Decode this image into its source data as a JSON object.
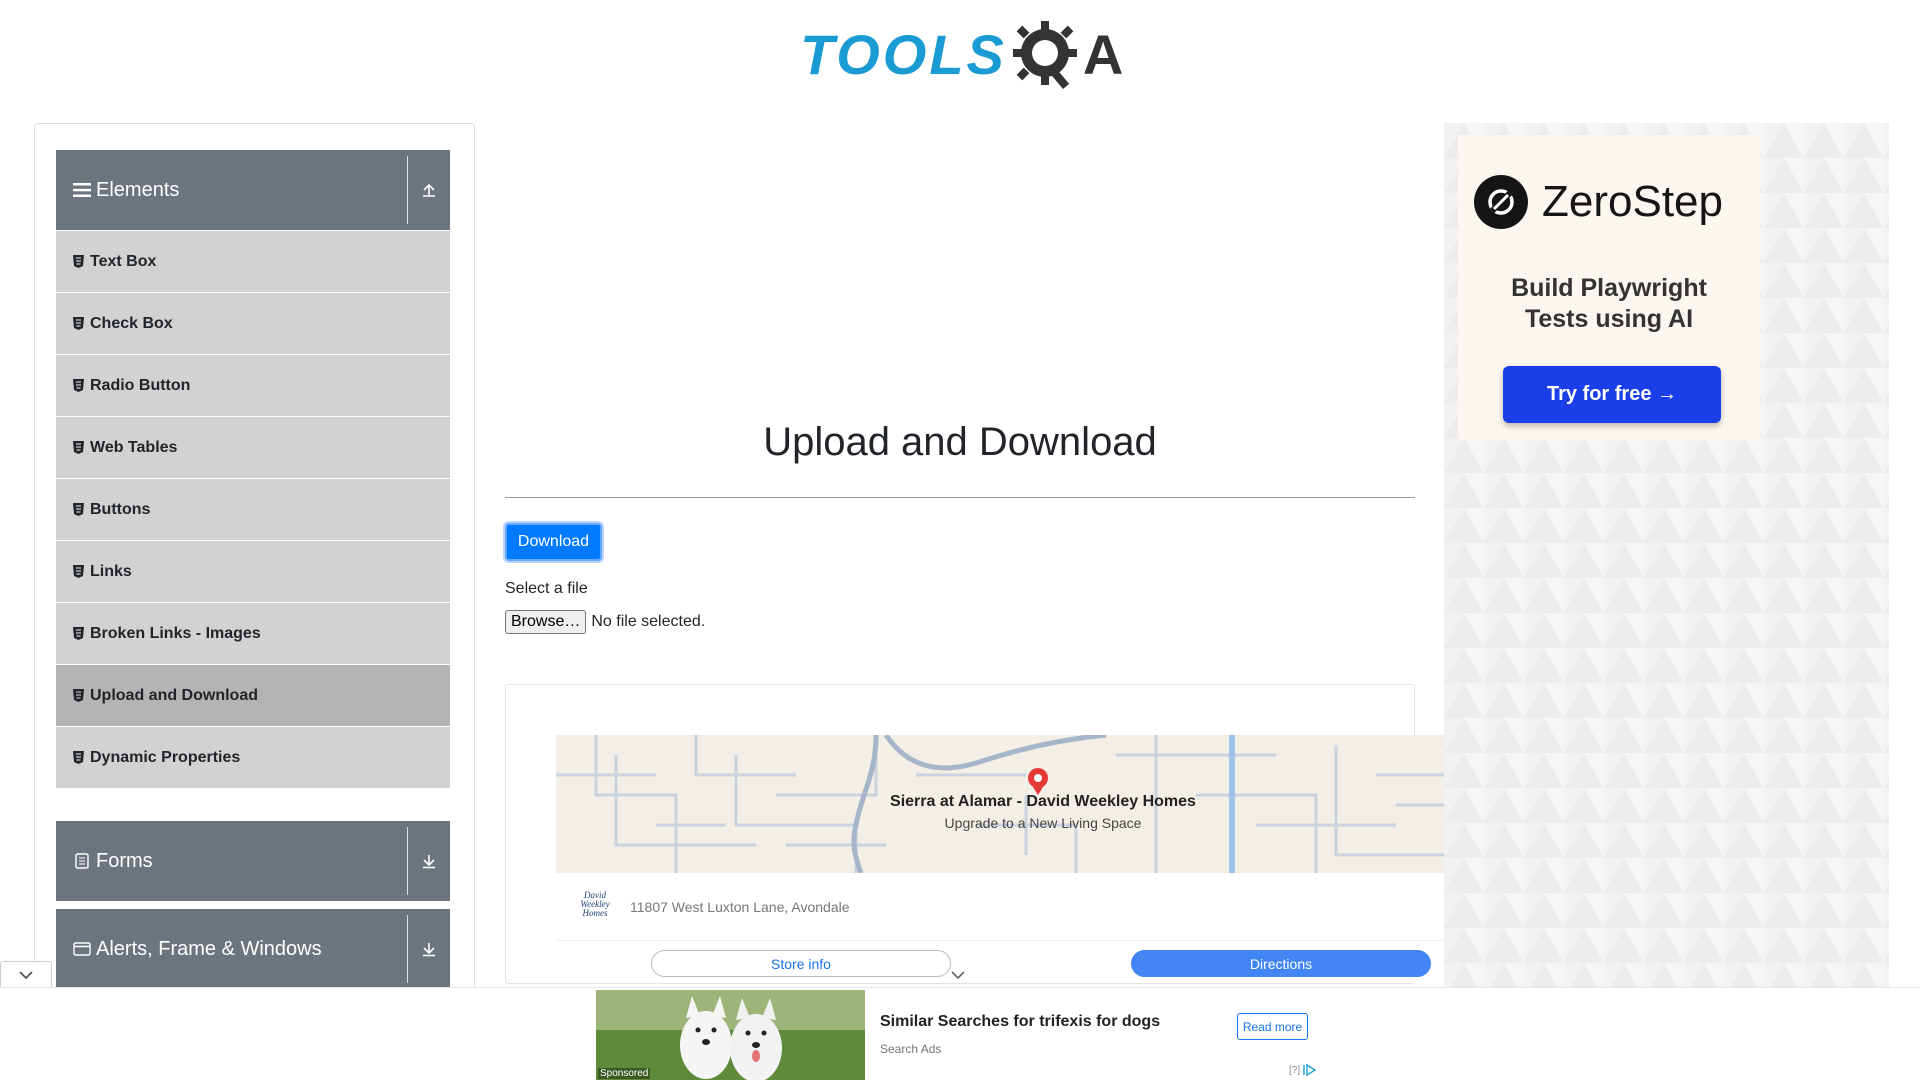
{
  "header": {
    "logo_text_left": "TOOLS",
    "logo_text_right": "A",
    "logo_alt": "TOOLSQA"
  },
  "sidebar": {
    "groups": [
      {
        "title": "Elements",
        "icon": "hamburger-icon",
        "toggle_icon": "collapse-up-icon",
        "expanded": true
      },
      {
        "title": "Forms",
        "icon": "form-icon",
        "toggle_icon": "expand-down-icon",
        "expanded": false
      },
      {
        "title": "Alerts, Frame & Windows",
        "icon": "window-icon",
        "toggle_icon": "expand-down-icon",
        "expanded": false
      }
    ],
    "items": [
      {
        "label": "Text Box",
        "active": false
      },
      {
        "label": "Check Box",
        "active": false
      },
      {
        "label": "Radio Button",
        "active": false
      },
      {
        "label": "Web Tables",
        "active": false
      },
      {
        "label": "Buttons",
        "active": false
      },
      {
        "label": "Links",
        "active": false
      },
      {
        "label": "Broken Links - Images",
        "active": false
      },
      {
        "label": "Upload and Download",
        "active": true
      },
      {
        "label": "Dynamic Properties",
        "active": false
      }
    ]
  },
  "main": {
    "title": "Upload and Download",
    "download_label": "Download",
    "select_label": "Select a file",
    "browse_label": "Browse…",
    "file_status": "No file selected."
  },
  "map_ad": {
    "place_name": "Sierra at Alamar - David Weekley Homes",
    "place_sub": "Upgrade to a New Living Space",
    "logo_text": "David Weekley Homes",
    "address": "11807 West Luxton Lane, Avondale",
    "store_info_label": "Store info",
    "directions_label": "Directions"
  },
  "right_ad": {
    "brand": "ZeroStep",
    "tagline_line1": "Build Playwright",
    "tagline_line2": "Tests using AI",
    "cta": "Try for free →",
    "cta_color": "#1a3fe8"
  },
  "bottom_ad": {
    "title": "Similar Searches for trifexis for dogs",
    "source": "Search Ads",
    "read_more": "Read more",
    "sponsored": "Sponsored",
    "choices": "[?]"
  },
  "colors": {
    "brand_blue": "#1b9bd4",
    "sidebar_header": "#6c757d",
    "sidebar_item": "#d2d2d2",
    "sidebar_item_active": "#b4b4b4",
    "primary_button": "#007bff"
  }
}
